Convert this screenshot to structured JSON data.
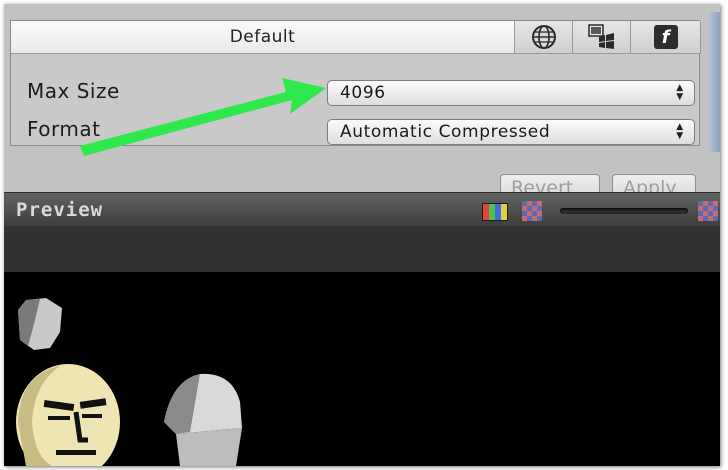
{
  "platform_tabs": {
    "default_label": "Default",
    "icons": [
      "globe-icon",
      "windows-icon",
      "flash-icon"
    ],
    "flash_glyph": "f"
  },
  "settings": {
    "max_size": {
      "label": "Max Size",
      "value": "4096"
    },
    "format": {
      "label": "Format",
      "value": "Automatic Compressed"
    }
  },
  "buttons": {
    "revert": "Revert",
    "apply": "Apply"
  },
  "preview": {
    "title": "Preview"
  },
  "colors": {
    "annotation_arrow": "#2ee84c",
    "panel_bg": "#c2c2c2",
    "preview_header": "#4a4a4a",
    "preview_bg": "#000000"
  }
}
